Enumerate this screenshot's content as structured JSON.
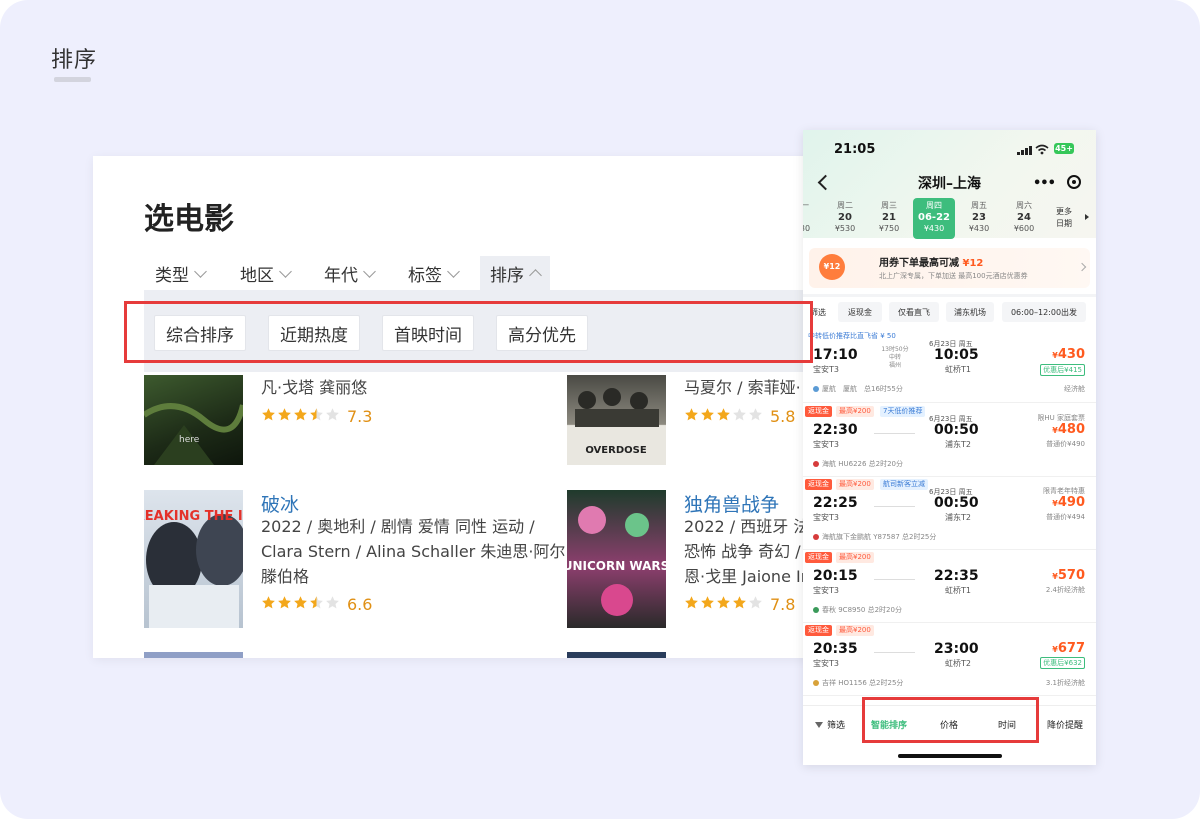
{
  "page": {
    "title": "排序"
  },
  "movies": {
    "heading": "选电影",
    "filters": [
      "类型",
      "地区",
      "年代",
      "标签",
      "排序"
    ],
    "active_filter": 4,
    "sort_options": [
      "综合排序",
      "近期热度",
      "首映时间",
      "高分优先"
    ],
    "cards": [
      {
        "title": "",
        "meta": [
          "凡·戈塔 龚丽悠"
        ],
        "score": "7.3",
        "stars": 3.5,
        "poster": "here"
      },
      {
        "title": "",
        "meta": [
          "马夏尔 / 索菲娅·"
        ],
        "score": "5.8",
        "stars": 3,
        "poster": "OVERDOSE"
      },
      {
        "title": "破冰",
        "meta": [
          "2022 / 奥地利 / 剧情 爱情 同性 运动 /",
          "Clara Stern / Alina Schaller 朱迪思·阿尔",
          "滕伯格"
        ],
        "score": "6.6",
        "stars": 3.5,
        "poster": "BREAKING THE ICE"
      },
      {
        "title": "独角兽战争",
        "meta": [
          "2022 / 西班牙 法",
          "恐怖 战争 奇幻 /",
          "恩·戈里 Jaione In"
        ],
        "score": "7.8",
        "stars": 4,
        "poster": "UNICORN WARS"
      }
    ]
  },
  "phone": {
    "status_time": "21:05",
    "battery": "45+",
    "route": "深圳–上海",
    "more_icon": "•••",
    "dates": [
      {
        "week": "一",
        "day": "",
        "price": "30"
      },
      {
        "week": "周二",
        "day": "20",
        "price": "¥530"
      },
      {
        "week": "周三",
        "day": "21",
        "price": "¥750"
      },
      {
        "week": "周四",
        "day": "06-22",
        "price": "¥430",
        "active": true
      },
      {
        "week": "周五",
        "day": "23",
        "price": "¥430"
      },
      {
        "week": "周六",
        "day": "24",
        "price": "¥600"
      }
    ],
    "more_dates": [
      "更多",
      "日期"
    ],
    "coupon": {
      "icon_text": "¥12",
      "title": "用券下单最高可减",
      "amount": "¥12",
      "sub": "北上广深专属，下单加送 最高100元酒店优惠券"
    },
    "chips": [
      "筛选",
      "返现金",
      "仅看直飞",
      "浦东机场",
      "06:00–12:00出发"
    ],
    "flights": [
      {
        "banner": "中转低价推荐比直飞省 ¥ 50",
        "dep": "17:10",
        "dep_apt": "宝安T3",
        "mid": [
          "13时50分",
          "中转",
          "福州"
        ],
        "arr_date": "6月23日 周五",
        "arr": "10:05",
        "arr_apt": "虹桥T1",
        "price": "430",
        "note": "优惠后¥415",
        "note_box": true,
        "airline": "厦航　厦航　总16时55分",
        "cabin": "经济舱"
      },
      {
        "tags": [
          "返现金",
          "最高¥200",
          "7天低价推荐"
        ],
        "dep": "22:30",
        "dep_apt": "宝安T3",
        "arr_date": "6月23日 周五",
        "arr": "00:50",
        "arr_apt": "浦东T2",
        "extra": "限HU 家庭套票",
        "price": "480",
        "note": "普通价¥490",
        "airline": "海航 HU6226 总2时20分"
      },
      {
        "tags": [
          "返现金",
          "最高¥200",
          "航司新客立减"
        ],
        "dep": "22:25",
        "dep_apt": "宝安T3",
        "arr_date": "6月23日 周五",
        "arr": "00:50",
        "arr_apt": "浦东T2",
        "extra": "限青老年特惠",
        "price": "490",
        "note": "普通价¥494",
        "airline": "海航旗下金鹏航 Y87587 总2时25分"
      },
      {
        "tags": [
          "返现金",
          "最高¥200"
        ],
        "dep": "20:15",
        "dep_apt": "宝安T3",
        "arr": "22:35",
        "arr_apt": "虹桥T1",
        "price": "570",
        "note": "2.4折经济舱",
        "airline": "春秋 9C8950 总2时20分"
      },
      {
        "tags": [
          "返现金",
          "最高¥200"
        ],
        "dep": "20:35",
        "dep_apt": "宝安T3",
        "arr": "23:00",
        "arr_apt": "虹桥T2",
        "price": "677",
        "note": "优惠后¥632",
        "note_box": true,
        "airline": "吉祥 HO1156 总2时25分",
        "cabin": "3.1折经济舱"
      }
    ],
    "bottom": [
      "筛选",
      "智能排序",
      "价格",
      "时间",
      "降价提醒"
    ],
    "bottom_active": 1
  },
  "colors": {
    "accent_green": "#3dbd7d",
    "highlight_red": "#e63b3b",
    "price_orange": "#ff5a1f",
    "link_blue": "#2f75b8"
  }
}
